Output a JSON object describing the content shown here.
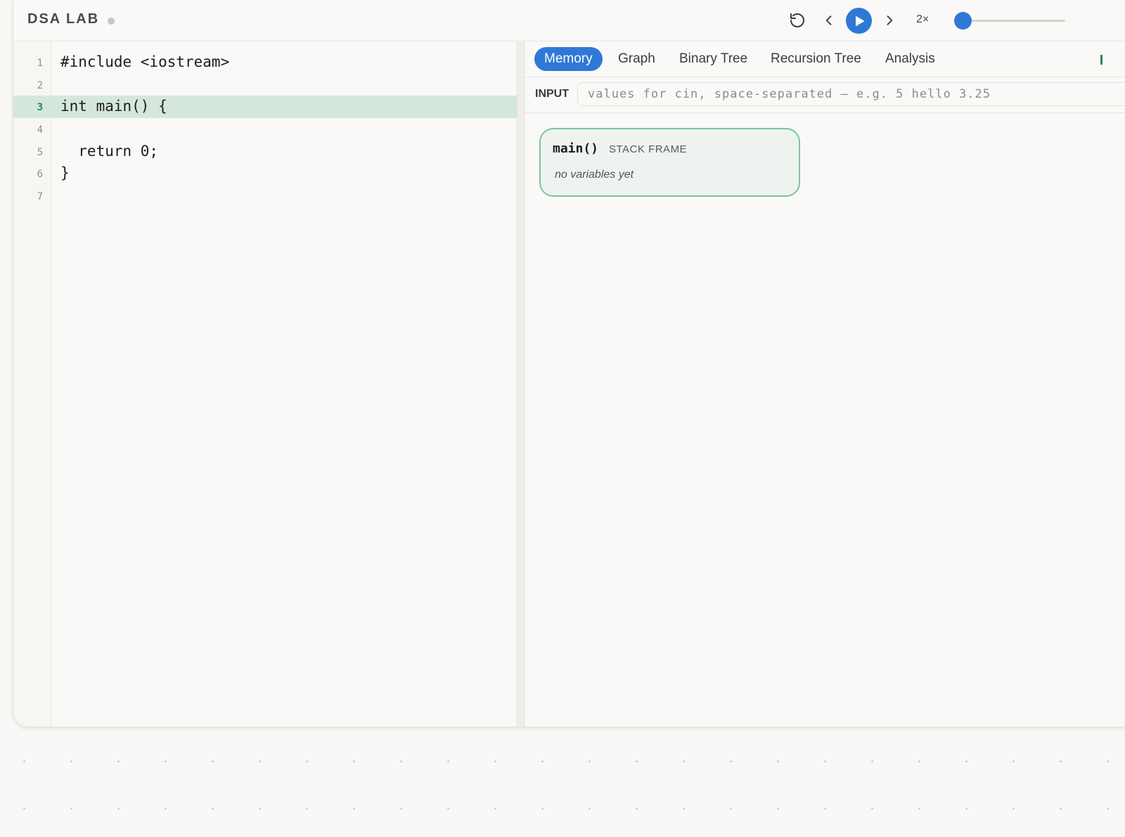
{
  "app": {
    "title": "DSA LAB"
  },
  "toolbar": {
    "reset_icon": "rotate-ccw-icon",
    "prev_icon": "chevron-left-icon",
    "play_icon": "play-icon",
    "next_icon": "chevron-right-icon",
    "speed_label": "2×",
    "progress": 0,
    "accent_color": "#2f78d6"
  },
  "editor": {
    "active_line": 3,
    "lines": [
      {
        "num": "1",
        "text": "#include <iostream>"
      },
      {
        "num": "2",
        "text": ""
      },
      {
        "num": "3",
        "text": "int main() {"
      },
      {
        "num": "4",
        "text": ""
      },
      {
        "num": "5",
        "text": "  return 0;"
      },
      {
        "num": "6",
        "text": "}"
      },
      {
        "num": "7",
        "text": ""
      }
    ],
    "highlight_color": "#d5e7dd"
  },
  "panel": {
    "tabs": [
      {
        "label": "Memory",
        "active": true
      },
      {
        "label": "Graph",
        "active": false
      },
      {
        "label": "Binary Tree",
        "active": false
      },
      {
        "label": "Recursion Tree",
        "active": false
      },
      {
        "label": "Analysis",
        "active": false
      }
    ],
    "input": {
      "label": "INPUT",
      "value": "",
      "placeholder": "values for cin, space-separated — e.g. 5 hello 3.25"
    },
    "frame": {
      "name": "main()",
      "kind": "STACK FRAME",
      "empty_text": "no variables yet",
      "border_color": "#7cc3a3"
    }
  }
}
